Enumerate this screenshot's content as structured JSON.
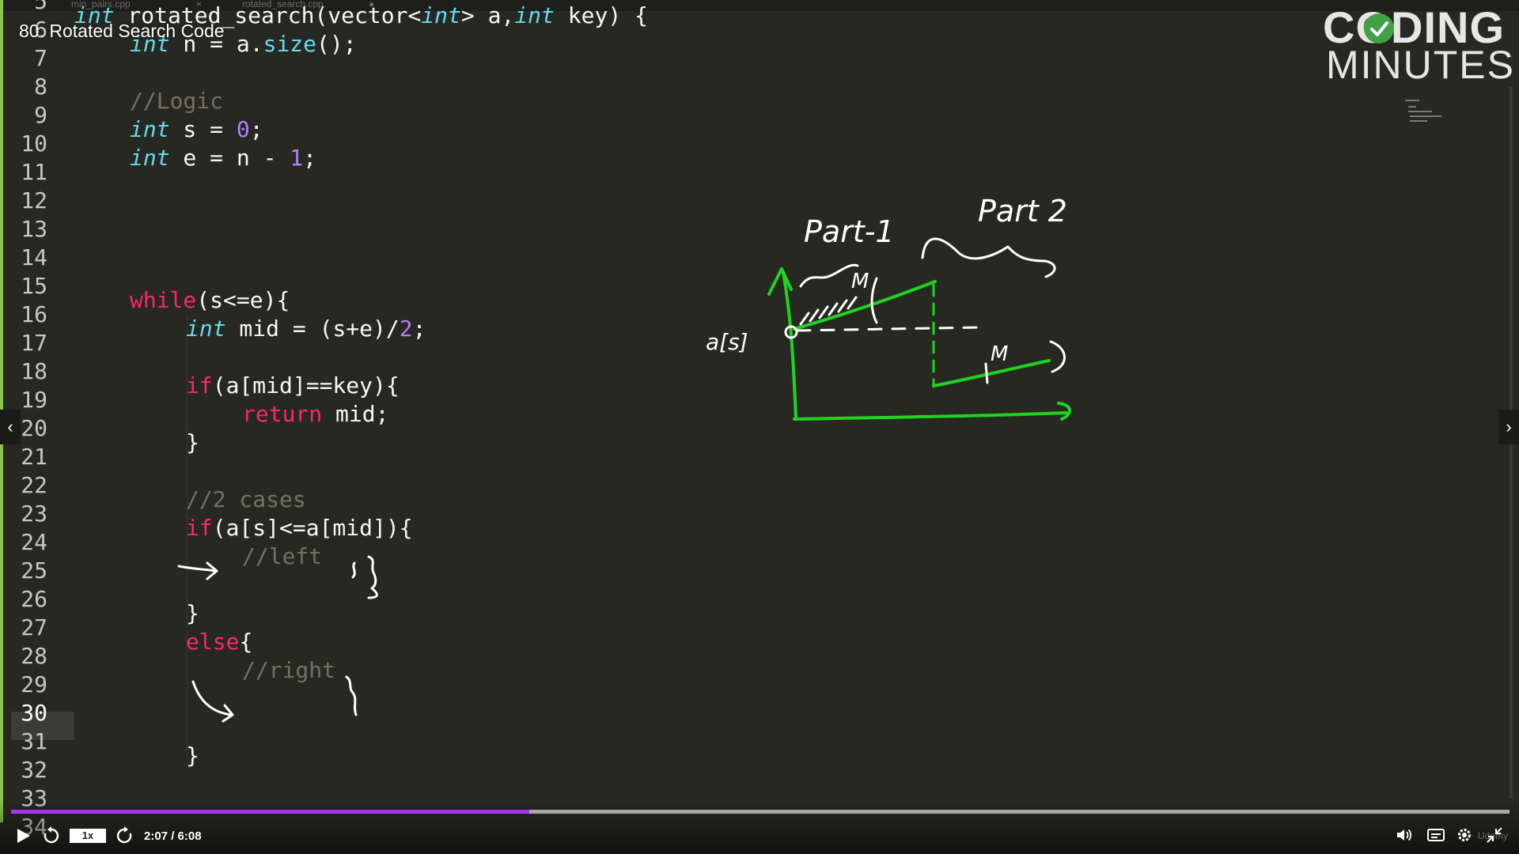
{
  "video": {
    "title": "80. Rotated Search Code",
    "brand_line1": "CODING",
    "brand_line2": "MINUTES",
    "watermark": "Udemy"
  },
  "editor": {
    "tabs": [
      {
        "label": "min_pairs.cpp"
      },
      {
        "label": "rotated_search.cpp"
      }
    ],
    "current_line": "30",
    "line_numbers": [
      "5",
      "6",
      "7",
      "8",
      "9",
      "10",
      "11",
      "12",
      "13",
      "14",
      "15",
      "16",
      "17",
      "18",
      "19",
      "20",
      "21",
      "22",
      "23",
      "24",
      "25",
      "26",
      "27",
      "28",
      "29",
      "30",
      "31",
      "32",
      "33",
      "34"
    ],
    "code": {
      "l5": {
        "t1": "int",
        "t2": " rotated_search(vector<",
        "t3": "int",
        "t4": "> a,",
        "t5": "int",
        "t6": " key) {"
      },
      "l6": {
        "t1": "int",
        "t2": " n = a.",
        "t3": "size",
        "t4": "();"
      },
      "l8": {
        "t1": "//Logic"
      },
      "l9": {
        "t1": "int",
        "t2": " s = ",
        "t3": "0",
        "t4": ";"
      },
      "l10": {
        "t1": "int",
        "t2": " e = n - ",
        "t3": "1",
        "t4": ";"
      },
      "l15": {
        "t1": "while",
        "t2": "(s<=e){"
      },
      "l16": {
        "t1": "int",
        "t2": " mid = (s+e)/",
        "t3": "2",
        "t4": ";"
      },
      "l18": {
        "t1": "if",
        "t2": "(a[mid]==key){"
      },
      "l19": {
        "t1": "return",
        "t2": " mid;"
      },
      "l20": {
        "t1": "}"
      },
      "l22": {
        "t1": "//2 cases"
      },
      "l23": {
        "t1": "if",
        "t2": "(a[s]<=a[mid]){"
      },
      "l24": {
        "t1": "//left"
      },
      "l26": {
        "t1": "}"
      },
      "l27": {
        "t1": "else",
        "t2": "{"
      },
      "l28": {
        "t1": "//right"
      },
      "l31": {
        "t1": "}"
      }
    }
  },
  "annotations": {
    "part1": "Part-1",
    "part2": "Part 2",
    "as_label": "a[s]",
    "m_upper": "M",
    "m_lower": "M"
  },
  "player": {
    "speed": "1x",
    "time": "2:07 / 6:08",
    "progress": 0.346
  },
  "colors": {
    "editor_bg": "#272822",
    "keyword": "#f92672",
    "type": "#66d9ef",
    "number": "#ae81ff",
    "comment": "#75715e",
    "ink_green": "#1fd41f",
    "ink_white": "#ffffff",
    "progress_purple": "#a435f0"
  },
  "icons": [
    "play-icon",
    "rewind-5-icon",
    "forward-5-icon",
    "volume-icon",
    "captions-icon",
    "settings-gear-icon",
    "exit-fullscreen-icon",
    "chevron-left-icon",
    "chevron-right-icon"
  ]
}
